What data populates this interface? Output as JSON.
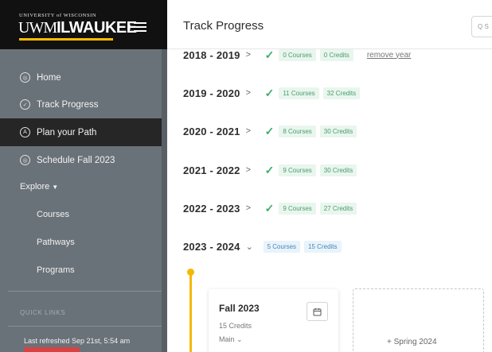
{
  "brand": {
    "top": "UNIVERSITY of WISCONSIN",
    "uwm": "UWM",
    "name": "ILWAUKEE"
  },
  "nav": {
    "home": "Home",
    "track_progress": "Track Progress",
    "plan_path": "Plan your Path",
    "schedule": "Schedule Fall 2023",
    "explore": "Explore",
    "courses": "Courses",
    "pathways": "Pathways",
    "programs": "Programs"
  },
  "sidebar": {
    "quick_links": "QUICK LINKS",
    "refreshed": "Last refreshed Sep 21st, 5:54 am"
  },
  "header": {
    "title": "Track Progress",
    "search_placeholder": "Q S"
  },
  "years": [
    {
      "label": "2018 - 2019",
      "chevron": ">",
      "courses": "0 Courses",
      "credits": "0 Credits",
      "action": "remove year"
    },
    {
      "label": "2019 - 2020",
      "chevron": ">",
      "courses": "11 Courses",
      "credits": "32 Credits"
    },
    {
      "label": "2020 - 2021",
      "chevron": ">",
      "courses": "8 Courses",
      "credits": "30 Credits"
    },
    {
      "label": "2021 - 2022",
      "chevron": ">",
      "courses": "9 Courses",
      "credits": "30 Credits"
    },
    {
      "label": "2022 - 2023",
      "chevron": ">",
      "courses": "9 Courses",
      "credits": "27 Credits"
    },
    {
      "label": "2023 - 2024",
      "chevron": "⌄",
      "courses": "5 Courses",
      "credits": "15 Credits"
    }
  ],
  "term": {
    "title": "Fall 2023",
    "credits": "15 Credits",
    "main": "Main ⌄"
  },
  "add_term": "+ Spring 2024",
  "colors": {
    "accent": "#f5b800",
    "complete_green": "#3fae6e",
    "sidebar": "#6a7279",
    "active_nav": "#262626"
  }
}
